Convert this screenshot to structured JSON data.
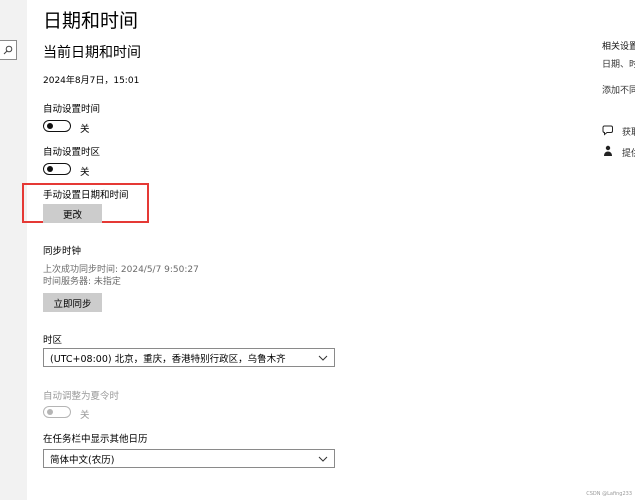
{
  "page_title": "日期和时间",
  "section_title": "当前日期和时间",
  "current_datetime": "2024年8月7日，15:01",
  "auto_time": {
    "label": "自动设置时间",
    "state": "关"
  },
  "auto_timezone": {
    "label": "自动设置时区",
    "state": "关"
  },
  "manual": {
    "label": "手动设置日期和时间",
    "button": "更改"
  },
  "sync": {
    "label": "同步时钟",
    "last_sync": "上次成功同步时间: 2024/5/7 9:50:27",
    "server": "时间服务器: 未指定",
    "button": "立即同步"
  },
  "timezone": {
    "label": "时区",
    "value": "(UTC+08:00) 北京，重庆，香港特别行政区，乌鲁木齐"
  },
  "dst": {
    "label": "自动调整为夏令时",
    "state": "关"
  },
  "extra_calendar": {
    "label": "在任务栏中显示其他日历",
    "value": "简体中文(农历)"
  },
  "right_panel": {
    "title": "相关设置",
    "line1": "日期、时",
    "line2": "添加不同",
    "help1": "获取",
    "help2": "提供"
  },
  "watermark": "CSDN @Lafing233",
  "icons": {
    "search": "search-icon",
    "dropdown": "chevron-down-icon",
    "help": "chat-help-icon",
    "feedback": "feedback-icon"
  }
}
